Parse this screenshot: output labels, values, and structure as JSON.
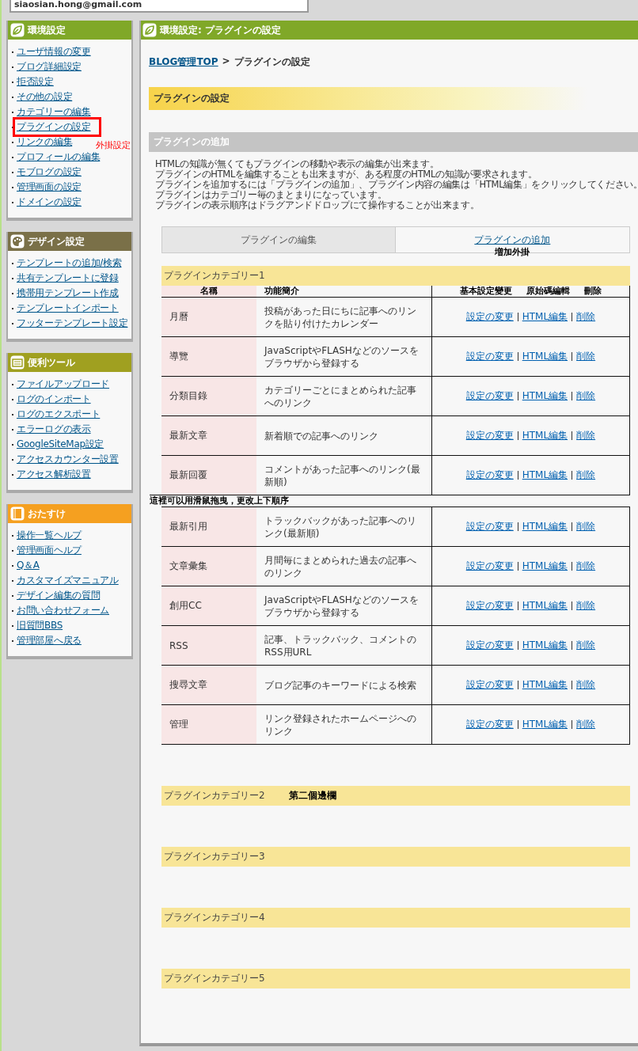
{
  "account": "siaosian.hong@gmail.com",
  "sidebar": [
    {
      "title": "環境設定",
      "kind": "leaf",
      "color": "#80a828",
      "items": [
        {
          "label": "ユーザ情報の変更",
          "highlighted": false
        },
        {
          "label": "ブログ詳細設定",
          "highlighted": false
        },
        {
          "label": "拒否設定",
          "highlighted": false
        },
        {
          "label": "その他の設定",
          "highlighted": false
        },
        {
          "label": "カテゴリーの編集",
          "highlighted": false
        },
        {
          "label": "プラグインの設定",
          "highlighted": true
        },
        {
          "label": "リンクの編集",
          "highlighted": false,
          "note": "外掛設定"
        },
        {
          "label": "プロフィールの編集",
          "highlighted": false
        },
        {
          "label": "モブログの設定",
          "highlighted": false
        },
        {
          "label": "管理画面の設定",
          "highlighted": false
        },
        {
          "label": "ドメインの設定",
          "highlighted": false
        }
      ]
    },
    {
      "title": "デザイン設定",
      "kind": "palette",
      "color": "#7a7048",
      "items": [
        {
          "label": "テンプレートの追加/検索",
          "highlighted": false
        },
        {
          "label": "共有テンプレートに登録",
          "highlighted": false
        },
        {
          "label": "携帯用テンプレート作成",
          "highlighted": false
        },
        {
          "label": "テンプレートインポート",
          "highlighted": false
        },
        {
          "label": "フッターテンプレート設定",
          "highlighted": false
        }
      ]
    },
    {
      "title": "便利ツール",
      "kind": "toolbox",
      "color": "#a0a020",
      "items": [
        {
          "label": "ファイルアップロード",
          "highlighted": false
        },
        {
          "label": "ログのインポート",
          "highlighted": false
        },
        {
          "label": "ログのエクスポート",
          "highlighted": false
        },
        {
          "label": "エラーログの表示",
          "highlighted": false
        },
        {
          "label": "GoogleSiteMap設定",
          "highlighted": false
        },
        {
          "label": "アクセスカウンター設置",
          "highlighted": false
        },
        {
          "label": "アクセス解析設置",
          "highlighted": false
        }
      ]
    },
    {
      "title": "おたすけ",
      "kind": "book",
      "color": "#f5a020",
      "items": [
        {
          "label": "操作一覧ヘルプ",
          "highlighted": false
        },
        {
          "label": "管理画面ヘルプ",
          "highlighted": false
        },
        {
          "label": "Q＆A",
          "highlighted": false
        },
        {
          "label": "カスタマイズマニュアル",
          "highlighted": false
        },
        {
          "label": "デザイン編集の質問",
          "highlighted": false
        },
        {
          "label": "お問い合わせフォーム",
          "highlighted": false
        },
        {
          "label": "旧質問BBS",
          "highlighted": false
        },
        {
          "label": "管理部屋へ戻る",
          "highlighted": false
        }
      ]
    }
  ],
  "main": {
    "title": "環境設定: プラグインの設定",
    "breadcrumb": {
      "link": "BLOG管理TOP",
      "separator": ">",
      "current": "プラグインの設定"
    },
    "page_heading": "プラグインの設定",
    "section_heading": "プラグインの追加",
    "description": [
      "HTMLの知識が無くてもプラグインの移動や表示の編集が出来ます。",
      "プラグインのHTMLを編集することも出来ますが、ある程度のHTMLの知識が要求されます。",
      "プラグインを追加するには「プラグインの追加」、プラグイン内容の編集は「HTML編集」をクリックしてください。",
      "プラグインはカテゴリー毎のまとまりになっています。",
      "プラグインの表示順序はドラグアンドドロップにて操作することが出来ます。"
    ],
    "tabs": [
      {
        "label": "プラグインの編集",
        "selected": true
      },
      {
        "label": "プラグインの追加",
        "selected": false,
        "note": "増加外掛"
      }
    ],
    "categories": [
      {
        "title": "プラグインカテゴリー1",
        "column_labels": [
          "名稱",
          "功能簡介",
          "基本設定變更",
          "原始碼編輯",
          "刪除"
        ],
        "plugins": [
          {
            "name": "月曆",
            "description": "投稿があった日にちに記事へのリンクを貼り付けたカレンダー",
            "actions": [
              "設定の変更",
              "HTML編集",
              "削除"
            ]
          },
          {
            "name": "導覽",
            "description": "JavaScriptやFLASHなどのソースをブラウザから登録する",
            "actions": [
              "設定の変更",
              "HTML編集",
              "削除"
            ]
          },
          {
            "name": "分類目錄",
            "description": "カテゴリーごとにまとめられた記事へのリンク",
            "actions": [
              "設定の変更",
              "HTML編集",
              "削除"
            ]
          },
          {
            "name": "最新文章",
            "description": "新着順での記事へのリンク",
            "actions": [
              "設定の変更",
              "HTML編集",
              "削除"
            ]
          },
          {
            "name": "最新回覆",
            "description": "コメントがあった記事へのリンク(最新順)",
            "actions": [
              "設定の変更",
              "HTML編集",
              "削除"
            ],
            "note": "這裡可以用滑鼠拖曳，更改上下順序"
          },
          {
            "name": "最新引用",
            "description": "トラックバックがあった記事へのリンク(最新順)",
            "actions": [
              "設定の変更",
              "HTML編集",
              "削除"
            ]
          },
          {
            "name": "文章彙集",
            "description": "月間毎にまとめられた過去の記事へのリンク",
            "actions": [
              "設定の変更",
              "HTML編集",
              "削除"
            ]
          },
          {
            "name": "創用CC",
            "description": "JavaScriptやFLASHなどのソースをブラウザから登録する",
            "actions": [
              "設定の変更",
              "HTML編集",
              "削除"
            ]
          },
          {
            "name": "RSS",
            "description": "記事、トラックバック、コメントのRSS用URL",
            "actions": [
              "設定の変更",
              "HTML編集",
              "削除"
            ]
          },
          {
            "name": "搜尋文章",
            "description": "ブログ記事のキーワードによる検索",
            "actions": [
              "設定の変更",
              "HTML編集",
              "削除"
            ]
          },
          {
            "name": "管理",
            "description": "リンク登録されたホームページへのリンク",
            "actions": [
              "設定の変更",
              "HTML編集",
              "削除"
            ]
          }
        ]
      },
      {
        "title": "プラグインカテゴリー2",
        "note": "第二個邊欄"
      },
      {
        "title": "プラグインカテゴリー3"
      },
      {
        "title": "プラグインカテゴリー4"
      },
      {
        "title": "プラグインカテゴリー5"
      }
    ]
  }
}
